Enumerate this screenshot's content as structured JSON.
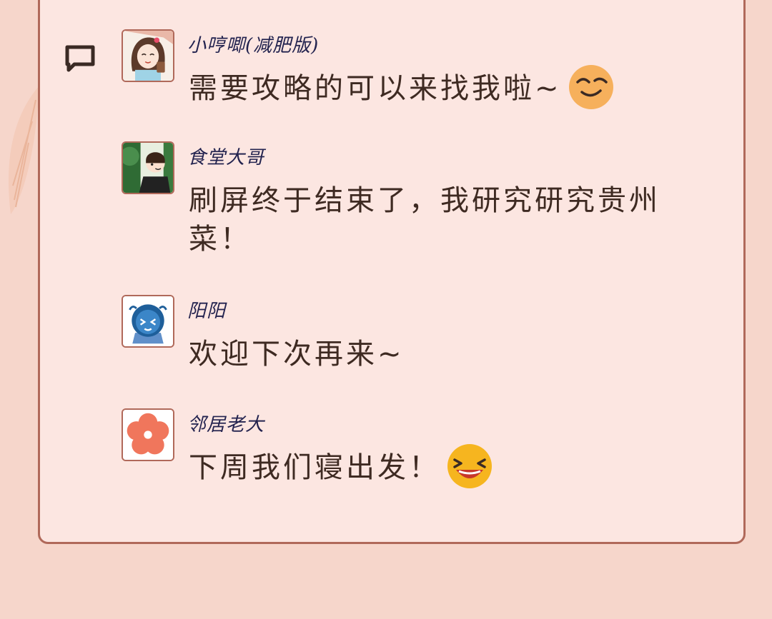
{
  "comments": [
    {
      "name": "小哼唧(减肥版)",
      "text": "需要攻略的可以来找我啦~",
      "emoji": "smirk-emoji-icon"
    },
    {
      "name": "食堂大哥",
      "text": "刷屏终于结束了，我研究研究贵州菜！"
    },
    {
      "name": "阳阳",
      "text": "欢迎下次再来~"
    },
    {
      "name": "邻居老大",
      "text": "下周我们寝出发！",
      "emoji": "laughing-emoji-icon"
    }
  ],
  "colors": {
    "background": "#f6d6cb",
    "card": "#fce6e1",
    "border": "#b0695a",
    "text": "#3e2a22",
    "name": "#23234f"
  }
}
